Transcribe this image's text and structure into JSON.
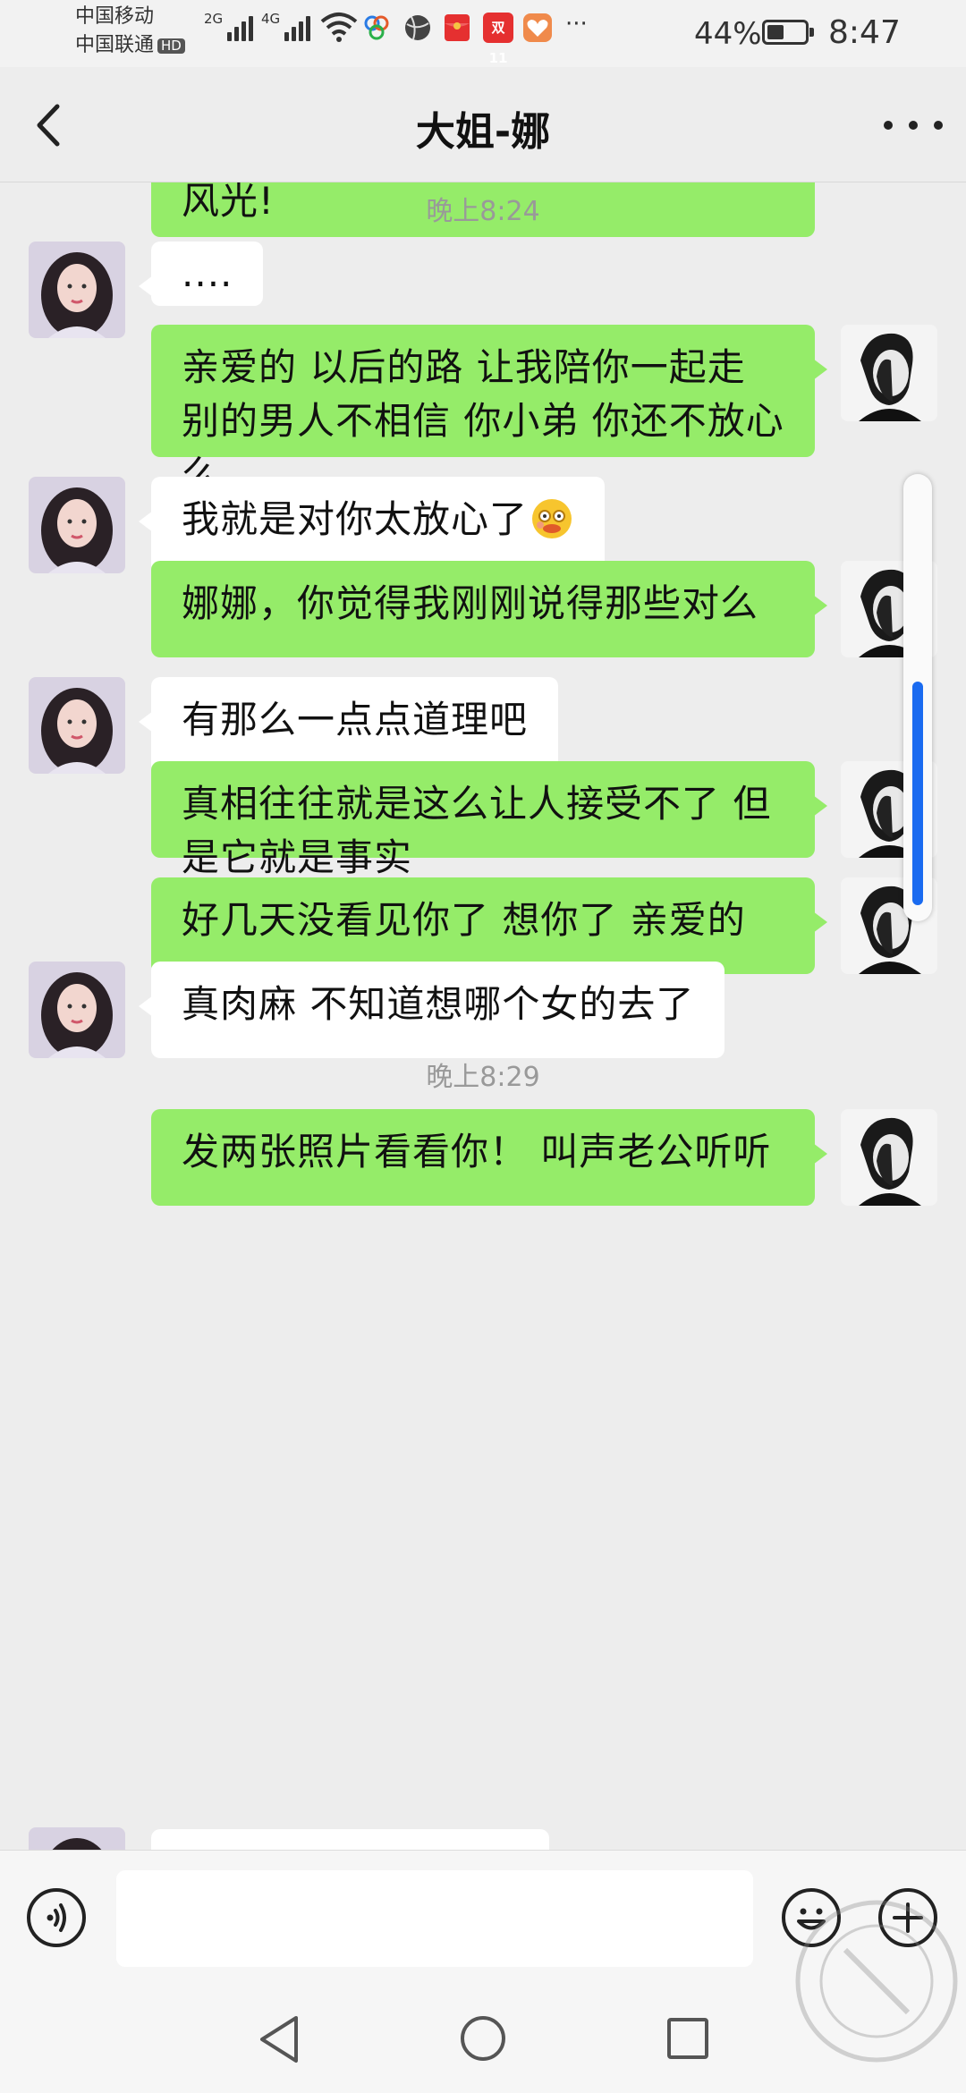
{
  "status_bar": {
    "carrier1": "中国移动",
    "carrier2": "中国联通",
    "hd_badge": "HD",
    "signal1_gen": "2G",
    "signal2_gen": "4G",
    "double11_label": "双11",
    "more_icons": "···",
    "battery_pct": "44%",
    "battery_level": 0.44,
    "time": "8:47"
  },
  "header": {
    "back_icon": "chevron-left-icon",
    "title": "大姐-娜",
    "more_icon": "more-dots-icon"
  },
  "messages": [
    {
      "side": "right",
      "text": "风光!"
    },
    {
      "type": "time",
      "text": "晚上8:24"
    },
    {
      "side": "left",
      "text": "...."
    },
    {
      "side": "right",
      "text": "亲爱的  以后的路 让我陪你一起走  别的男人不相信  你小弟 你还不放心么"
    },
    {
      "side": "left",
      "text": "我就是对你太放心了",
      "emoji": "emoji-face-icon"
    },
    {
      "side": "right",
      "text": " 娜娜，你觉得我刚刚说得那些对么"
    },
    {
      "side": "left",
      "text": "有那么一点点道理吧"
    },
    {
      "side": "right",
      "text": "真相往往就是这么让人接受不了 但是它就是事实"
    },
    {
      "side": "right",
      "text": "好几天没看见你了 想你了 亲爱的"
    },
    {
      "side": "left",
      "text": "真肉麻  不知道想哪个女的去了"
    },
    {
      "type": "time",
      "text": "晚上8:29"
    },
    {
      "side": "right",
      "text": "发两张照片看看你！ 叫声老公听听"
    }
  ],
  "input_bar": {
    "voice_icon": "voice-icon",
    "input_value": "",
    "emoji_icon": "emoji-icon",
    "plus_icon": "plus-icon"
  },
  "colors": {
    "outgoing_bubble": "#95ec69",
    "incoming_bubble": "#ffffff",
    "background": "#ededed",
    "scroll_thumb": "#1a6bf0"
  }
}
